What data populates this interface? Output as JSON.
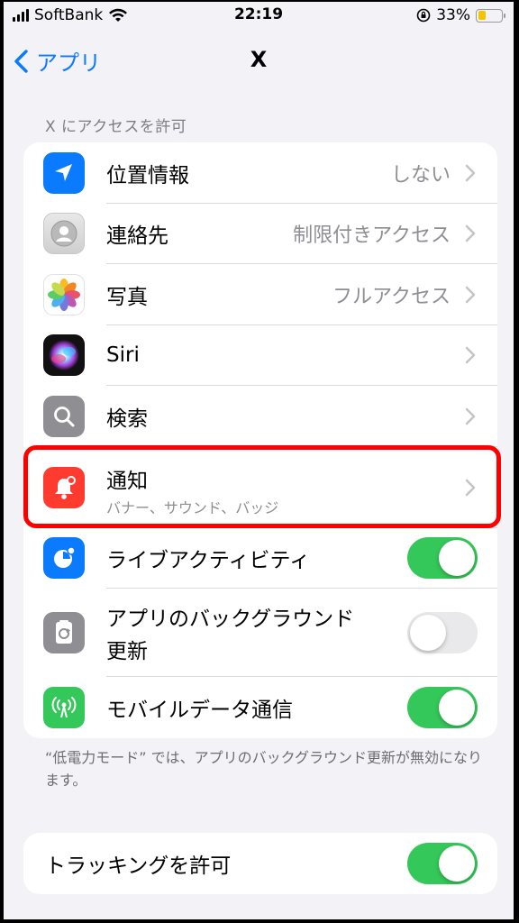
{
  "status_bar": {
    "carrier": "SoftBank",
    "time": "22:19",
    "battery_percent": "33%",
    "battery_level": 0.33,
    "battery_color": "#f5c400"
  },
  "nav": {
    "back_label": "アプリ",
    "title": "X"
  },
  "section_header": "X にアクセスを許可",
  "permissions": [
    {
      "label": "位置情報",
      "value": "しない",
      "icon": "location-arrow-icon",
      "color": "#0a7aff"
    },
    {
      "label": "連絡先",
      "value": "制限付きアクセス",
      "icon": "contacts-icon",
      "color": "#d9d9d9"
    },
    {
      "label": "写真",
      "value": "フルアクセス",
      "icon": "photos-icon",
      "color": "#ffffff"
    },
    {
      "label": "Siri",
      "value": "",
      "icon": "siri-icon",
      "color": "#111111"
    },
    {
      "label": "検索",
      "value": "",
      "icon": "search-icon",
      "color": "#8e8e93"
    },
    {
      "label": "通知",
      "sublabel": "バナー、サウンド、バッジ",
      "icon": "notification-bell-icon",
      "color": "#ff3b30"
    },
    {
      "label": "ライブアクティビティ",
      "toggle": true,
      "icon": "live-activity-icon",
      "color": "#0a7aff"
    },
    {
      "label_line1": "アプリのバックグラウンド",
      "label_line2": "更新",
      "toggle": false,
      "icon": "background-refresh-icon",
      "color": "#8e8e93"
    },
    {
      "label": "モバイルデータ通信",
      "toggle": true,
      "icon": "cellular-antenna-icon",
      "color": "#34c759"
    }
  ],
  "footer_note": "“低電力モード” では、アプリのバックグラウンド更新が無効になります。",
  "tracking": {
    "label": "トラッキングを許可",
    "toggle": true
  },
  "colors": {
    "accent": "#0a7aff",
    "toggle_on": "#34c759",
    "highlight": "#ff0000"
  }
}
